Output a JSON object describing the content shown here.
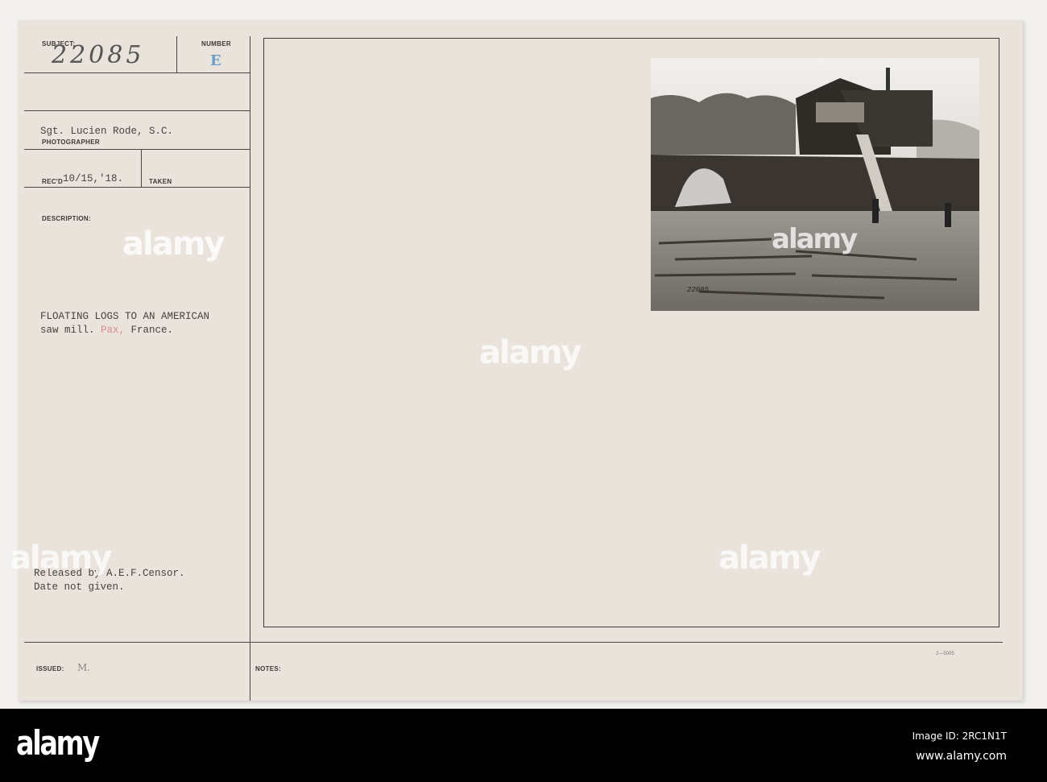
{
  "card": {
    "subject_label": "SUBJECT:",
    "subject_number": "22085",
    "number_label": "NUMBER",
    "number_value": "E",
    "photographer_name": "Sgt. Lucien Rode, S.C.",
    "photographer_label": "PHOTOGRAPHER",
    "recd_label": "REC'D",
    "recd_value": "10/15,'18.",
    "taken_label": "TAKEN",
    "description_label": "DESCRIPTION:",
    "description_line1": "FLOATING LOGS TO AN AMERICAN",
    "description_line2_a": "saw mill. ",
    "description_line2_place": "Pax,",
    "description_line2_b": " France.",
    "release_line1": "Released by A.E.F.Censor.",
    "release_line2": "Date not given.",
    "issued_label": "ISSUED:",
    "issued_value": "M.",
    "notes_label": "NOTES:",
    "form_code": "2—5005",
    "photo_inscription": "22085"
  },
  "colors": {
    "number_blue": "#6a9cc8",
    "place_red": "#d98a8a"
  },
  "watermark": "alamy",
  "banner": {
    "logo": "alamy",
    "image_id": "Image ID: 2RC1N1T",
    "url": "www.alamy.com"
  }
}
